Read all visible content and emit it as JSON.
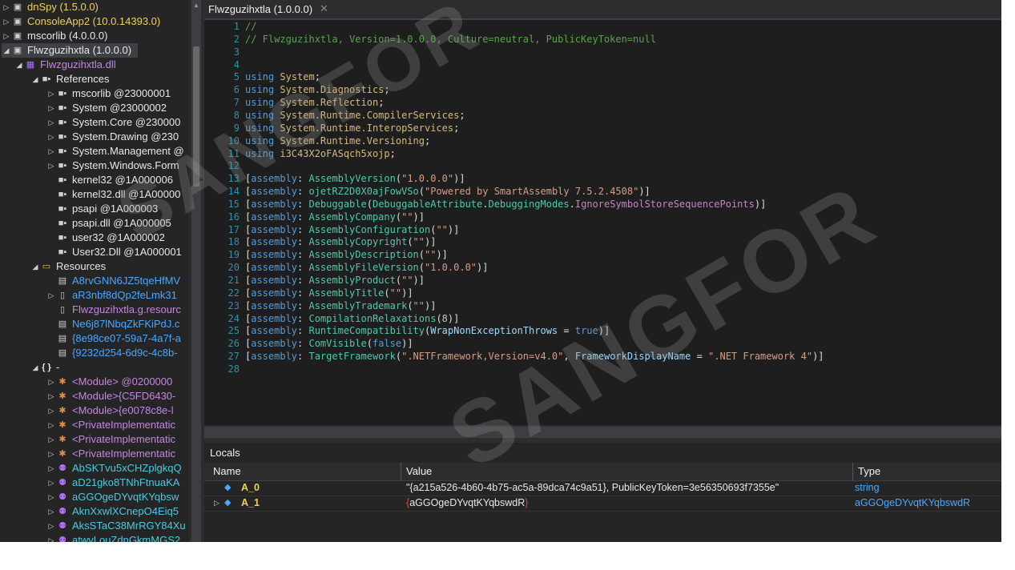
{
  "tree": {
    "rows": [
      {
        "expander": "▷",
        "icon": "▣",
        "label": "dnSpy (1.5.0.0)"
      },
      {
        "expander": "▷",
        "icon": "▣",
        "label": "ConsoleApp2 (10.0.14393.0)"
      },
      {
        "expander": "▷",
        "icon": "▣",
        "label": "mscorlib (4.0.0.0)"
      },
      {
        "expander": "◢",
        "icon": "▣",
        "label": "Flwzguzihxtla (1.0.0.0)"
      },
      {
        "expander": "◢",
        "icon": "▦",
        "label": "Flwzguzihxtla.dll"
      },
      {
        "expander": "◢",
        "icon": "■▪",
        "label": "References"
      },
      {
        "expander": "▷",
        "icon": "■▪",
        "label": "mscorlib @23000001"
      },
      {
        "expander": "▷",
        "icon": "■▪",
        "label": "System @23000002"
      },
      {
        "expander": "▷",
        "icon": "■▪",
        "label": "System.Core @230000"
      },
      {
        "expander": "▷",
        "icon": "■▪",
        "label": "System.Drawing @230"
      },
      {
        "expander": "▷",
        "icon": "■▪",
        "label": "System.Management @"
      },
      {
        "expander": "▷",
        "icon": "■▪",
        "label": "System.Windows.Form"
      },
      {
        "expander": "",
        "icon": "■▪",
        "label": "kernel32 @1A000006"
      },
      {
        "expander": "",
        "icon": "■▪",
        "label": "kernel32.dll @1A00000"
      },
      {
        "expander": "",
        "icon": "■▪",
        "label": "psapi @1A000003"
      },
      {
        "expander": "",
        "icon": "■▪",
        "label": "psapi.dll @1A000005"
      },
      {
        "expander": "",
        "icon": "■▪",
        "label": "user32 @1A000002"
      },
      {
        "expander": "",
        "icon": "■▪",
        "label": "User32.Dll @1A000001"
      },
      {
        "expander": "◢",
        "icon": "▭",
        "label": "Resources"
      },
      {
        "expander": "",
        "icon": "▤",
        "label": "A8rvGNN6JZ5tqeHfMV"
      },
      {
        "expander": "▷",
        "icon": "▯",
        "label": "aR3nbf8dQp2feLmk31"
      },
      {
        "expander": "",
        "icon": "▯",
        "label": "Flwzguzihxtla.g.resourc"
      },
      {
        "expander": "",
        "icon": "▤",
        "label": "Ne6j87lNbqZkFKiPdJ.c"
      },
      {
        "expander": "",
        "icon": "▤",
        "label": "{8e98ce07-59a7-4a7f-a"
      },
      {
        "expander": "",
        "icon": "▤",
        "label": "{9232d254-6d9c-4c8b-"
      },
      {
        "expander": "◢",
        "icon": "{ }",
        "label": "-"
      },
      {
        "expander": "▷",
        "icon": "✱",
        "label": "<Module> @0200000"
      },
      {
        "expander": "▷",
        "icon": "✱",
        "label": "<Module>{C5FD6430-"
      },
      {
        "expander": "▷",
        "icon": "✱",
        "label": "<Module>{e0078c8e-l"
      },
      {
        "expander": "▷",
        "icon": "✱",
        "label": "<PrivateImplementatic"
      },
      {
        "expander": "▷",
        "icon": "✱",
        "label": "<PrivateImplementatic"
      },
      {
        "expander": "▷",
        "icon": "✱",
        "label": "<PrivateImplementatic"
      },
      {
        "expander": "▷",
        "icon": "⚉",
        "label": "AbSKTvu5xCHZplgkqQ"
      },
      {
        "expander": "▷",
        "icon": "⚉",
        "label": "aD21gko8TNhFtnuaKA"
      },
      {
        "expander": "▷",
        "icon": "⚉",
        "label": "aGGOgeDYvqtKYqbsw"
      },
      {
        "expander": "▷",
        "icon": "⚉",
        "label": "AknXxwlXCnepO4Eiq5"
      },
      {
        "expander": "▷",
        "icon": "⚉",
        "label": "AksSTaC38MrRGY84Xu"
      },
      {
        "expander": "▷",
        "icon": "⚉",
        "label": "atwvLouZdnGkmMGS2"
      }
    ]
  },
  "tab": {
    "title": "Flwzguzihxtla (1.0.0.0)",
    "close": "✕"
  },
  "code": {
    "line_numbers": [
      "1",
      "2",
      "3",
      "4",
      "5",
      "6",
      "7",
      "8",
      "9",
      "10",
      "11",
      "12",
      "13",
      "14",
      "15",
      "16",
      "17",
      "18",
      "19",
      "20",
      "21",
      "22",
      "23",
      "24",
      "25",
      "26",
      "27",
      "28"
    ],
    "lines": [
      [
        {
          "t": "comment",
          "v": "//"
        }
      ],
      [
        {
          "t": "comment",
          "v": "// Flwzguzihxtla, Version=1.0.0.0, Culture=neutral, PublicKeyToken=null"
        }
      ],
      [],
      [],
      [
        {
          "t": "kw",
          "v": "using "
        },
        {
          "t": "ns",
          "v": "System"
        },
        {
          "t": "plain",
          "v": ";"
        }
      ],
      [
        {
          "t": "kw",
          "v": "using "
        },
        {
          "t": "ns",
          "v": "System.Diagnostics"
        },
        {
          "t": "plain",
          "v": ";"
        }
      ],
      [
        {
          "t": "kw",
          "v": "using "
        },
        {
          "t": "ns",
          "v": "System.Reflection"
        },
        {
          "t": "plain",
          "v": ";"
        }
      ],
      [
        {
          "t": "kw",
          "v": "using "
        },
        {
          "t": "ns",
          "v": "System.Runtime.CompilerServices"
        },
        {
          "t": "plain",
          "v": ";"
        }
      ],
      [
        {
          "t": "kw",
          "v": "using "
        },
        {
          "t": "ns",
          "v": "System.Runtime.InteropServices"
        },
        {
          "t": "plain",
          "v": ";"
        }
      ],
      [
        {
          "t": "kw",
          "v": "using "
        },
        {
          "t": "ns",
          "v": "System.Runtime.Versioning"
        },
        {
          "t": "plain",
          "v": ";"
        }
      ],
      [
        {
          "t": "kw",
          "v": "using "
        },
        {
          "t": "ns",
          "v": "i3C43X2oFASqch5xojp"
        },
        {
          "t": "plain",
          "v": ";"
        }
      ],
      [],
      [
        {
          "t": "plain",
          "v": "["
        },
        {
          "t": "kw",
          "v": "assembly"
        },
        {
          "t": "plain",
          "v": ": "
        },
        {
          "t": "type",
          "v": "AssemblyVersion"
        },
        {
          "t": "plain",
          "v": "("
        },
        {
          "t": "str",
          "v": "\"1.0.0.0\""
        },
        {
          "t": "plain",
          "v": ")]"
        }
      ],
      [
        {
          "t": "plain",
          "v": "["
        },
        {
          "t": "kw",
          "v": "assembly"
        },
        {
          "t": "plain",
          "v": ": "
        },
        {
          "t": "type",
          "v": "ojetRZ2D0X0ajFowVSo"
        },
        {
          "t": "plain",
          "v": "("
        },
        {
          "t": "str",
          "v": "\"Powered by SmartAssembly 7.5.2.4508\""
        },
        {
          "t": "plain",
          "v": ")]"
        }
      ],
      [
        {
          "t": "plain",
          "v": "["
        },
        {
          "t": "kw",
          "v": "assembly"
        },
        {
          "t": "plain",
          "v": ": "
        },
        {
          "t": "type",
          "v": "Debuggable"
        },
        {
          "t": "plain",
          "v": "("
        },
        {
          "t": "type",
          "v": "DebuggableAttribute"
        },
        {
          "t": "plain",
          "v": "."
        },
        {
          "t": "type",
          "v": "DebuggingModes"
        },
        {
          "t": "plain",
          "v": "."
        },
        {
          "t": "prop",
          "v": "IgnoreSymbolStoreSequencePoints"
        },
        {
          "t": "plain",
          "v": ")]"
        }
      ],
      [
        {
          "t": "plain",
          "v": "["
        },
        {
          "t": "kw",
          "v": "assembly"
        },
        {
          "t": "plain",
          "v": ": "
        },
        {
          "t": "type",
          "v": "AssemblyCompany"
        },
        {
          "t": "plain",
          "v": "("
        },
        {
          "t": "str",
          "v": "\"\""
        },
        {
          "t": "plain",
          "v": ")]"
        }
      ],
      [
        {
          "t": "plain",
          "v": "["
        },
        {
          "t": "kw",
          "v": "assembly"
        },
        {
          "t": "plain",
          "v": ": "
        },
        {
          "t": "type",
          "v": "AssemblyConfiguration"
        },
        {
          "t": "plain",
          "v": "("
        },
        {
          "t": "str",
          "v": "\"\""
        },
        {
          "t": "plain",
          "v": ")]"
        }
      ],
      [
        {
          "t": "plain",
          "v": "["
        },
        {
          "t": "kw",
          "v": "assembly"
        },
        {
          "t": "plain",
          "v": ": "
        },
        {
          "t": "type",
          "v": "AssemblyCopyright"
        },
        {
          "t": "plain",
          "v": "("
        },
        {
          "t": "str",
          "v": "\"\""
        },
        {
          "t": "plain",
          "v": ")]"
        }
      ],
      [
        {
          "t": "plain",
          "v": "["
        },
        {
          "t": "kw",
          "v": "assembly"
        },
        {
          "t": "plain",
          "v": ": "
        },
        {
          "t": "type",
          "v": "AssemblyDescription"
        },
        {
          "t": "plain",
          "v": "("
        },
        {
          "t": "str",
          "v": "\"\""
        },
        {
          "t": "plain",
          "v": ")]"
        }
      ],
      [
        {
          "t": "plain",
          "v": "["
        },
        {
          "t": "kw",
          "v": "assembly"
        },
        {
          "t": "plain",
          "v": ": "
        },
        {
          "t": "type",
          "v": "AssemblyFileVersion"
        },
        {
          "t": "plain",
          "v": "("
        },
        {
          "t": "str",
          "v": "\"1.0.0.0\""
        },
        {
          "t": "plain",
          "v": ")]"
        }
      ],
      [
        {
          "t": "plain",
          "v": "["
        },
        {
          "t": "kw",
          "v": "assembly"
        },
        {
          "t": "plain",
          "v": ": "
        },
        {
          "t": "type",
          "v": "AssemblyProduct"
        },
        {
          "t": "plain",
          "v": "("
        },
        {
          "t": "str",
          "v": "\"\""
        },
        {
          "t": "plain",
          "v": ")]"
        }
      ],
      [
        {
          "t": "plain",
          "v": "["
        },
        {
          "t": "kw",
          "v": "assembly"
        },
        {
          "t": "plain",
          "v": ": "
        },
        {
          "t": "type",
          "v": "AssemblyTitle"
        },
        {
          "t": "plain",
          "v": "("
        },
        {
          "t": "str",
          "v": "\"\""
        },
        {
          "t": "plain",
          "v": ")]"
        }
      ],
      [
        {
          "t": "plain",
          "v": "["
        },
        {
          "t": "kw",
          "v": "assembly"
        },
        {
          "t": "plain",
          "v": ": "
        },
        {
          "t": "type",
          "v": "AssemblyTrademark"
        },
        {
          "t": "plain",
          "v": "("
        },
        {
          "t": "str",
          "v": "\"\""
        },
        {
          "t": "plain",
          "v": ")]"
        }
      ],
      [
        {
          "t": "plain",
          "v": "["
        },
        {
          "t": "kw",
          "v": "assembly"
        },
        {
          "t": "plain",
          "v": ": "
        },
        {
          "t": "type",
          "v": "CompilationRelaxations"
        },
        {
          "t": "plain",
          "v": "("
        },
        {
          "t": "num",
          "v": "8"
        },
        {
          "t": "plain",
          "v": ")]"
        }
      ],
      [
        {
          "t": "plain",
          "v": "["
        },
        {
          "t": "kw",
          "v": "assembly"
        },
        {
          "t": "plain",
          "v": ": "
        },
        {
          "t": "type",
          "v": "RuntimeCompatibility"
        },
        {
          "t": "plain",
          "v": "("
        },
        {
          "t": "param",
          "v": "WrapNonExceptionThrows"
        },
        {
          "t": "plain",
          "v": " = "
        },
        {
          "t": "kw",
          "v": "true"
        },
        {
          "t": "plain",
          "v": ")]"
        }
      ],
      [
        {
          "t": "plain",
          "v": "["
        },
        {
          "t": "kw",
          "v": "assembly"
        },
        {
          "t": "plain",
          "v": ": "
        },
        {
          "t": "type",
          "v": "ComVisible"
        },
        {
          "t": "plain",
          "v": "("
        },
        {
          "t": "kw",
          "v": "false"
        },
        {
          "t": "plain",
          "v": ")]"
        }
      ],
      [
        {
          "t": "plain",
          "v": "["
        },
        {
          "t": "kw",
          "v": "assembly"
        },
        {
          "t": "plain",
          "v": ": "
        },
        {
          "t": "type",
          "v": "TargetFramework"
        },
        {
          "t": "plain",
          "v": "("
        },
        {
          "t": "str",
          "v": "\".NETFramework,Version=v4.0\""
        },
        {
          "t": "plain",
          "v": ", "
        },
        {
          "t": "param",
          "v": "FrameworkDisplayName"
        },
        {
          "t": "plain",
          "v": " = "
        },
        {
          "t": "str",
          "v": "\".NET Framework 4\""
        },
        {
          "t": "plain",
          "v": ")]"
        }
      ],
      []
    ]
  },
  "locals": {
    "title": "Locals",
    "columns": {
      "name": "Name",
      "value": "Value",
      "type": "Type"
    },
    "rows": [
      {
        "expander": "",
        "name": "A_0",
        "value": "\"{a215a526-4b60-4b75-ac5a-89dca74c9a51}, PublicKeyToken=3e56350693f7355e\"",
        "type": "string"
      },
      {
        "expander": "▷",
        "name": "A_1",
        "value": "aGGOgeDYvqtKYqbswdR",
        "type": "aGGOgeDYvqtKYqbswdR"
      }
    ]
  },
  "watermark": [
    "SANGFOR",
    "SANGFOR"
  ],
  "colors": {
    "tree_bg": "#252526",
    "editor_bg": "#1e1e1e",
    "line_number": "#2b91af",
    "keyword": "#569cd6",
    "namespace": "#d7ba7d",
    "type": "#4ec9b0",
    "string": "#d69d85",
    "comment": "#57a64a"
  }
}
